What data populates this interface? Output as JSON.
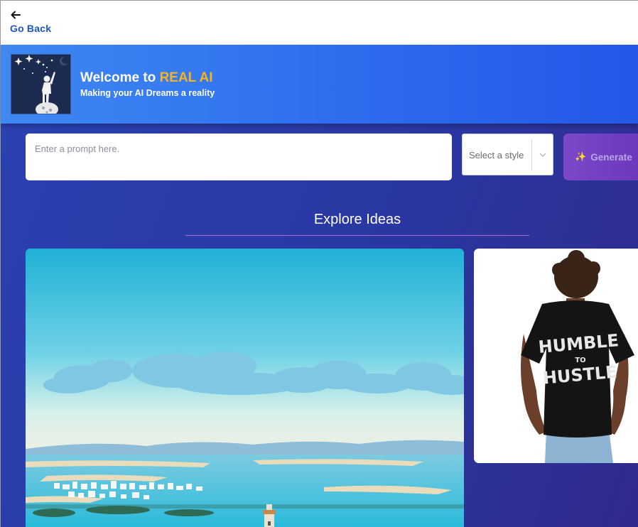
{
  "nav": {
    "back_label": "Go Back"
  },
  "header": {
    "title_prefix": "Welcome to ",
    "title_brand": "REAL AI",
    "subtitle": "Making your AI Dreams a reality"
  },
  "prompt": {
    "placeholder": "Enter a prompt here."
  },
  "style_select": {
    "selected": "Select a style"
  },
  "generate": {
    "icon": "✨",
    "label": "Generate"
  },
  "explore": {
    "title": "Explore Ideas",
    "shirt_text": [
      "HUMBLE",
      "TO",
      "HUSTLE"
    ]
  },
  "colors": {
    "accent_blue": "#2f6fef",
    "brand_gold": "#f5b51e",
    "generate_purple": "#6a36bd"
  }
}
